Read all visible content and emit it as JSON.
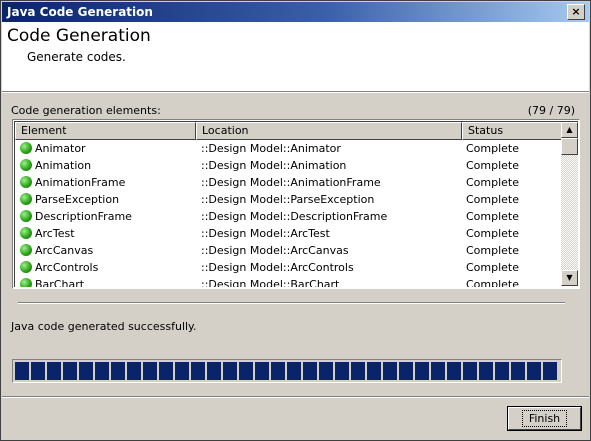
{
  "window": {
    "title": "Java Code Generation",
    "close_glyph": "×"
  },
  "header": {
    "title": "Code Generation",
    "subtitle": "Generate codes."
  },
  "list": {
    "label": "Code generation elements:",
    "count": "(79 / 79)",
    "columns": [
      "Element",
      "Location",
      "Status"
    ],
    "rows": [
      {
        "element": "Animator",
        "location": "::Design Model::Animator",
        "status": "Complete"
      },
      {
        "element": "Animation",
        "location": "::Design Model::Animation",
        "status": "Complete"
      },
      {
        "element": "AnimationFrame",
        "location": "::Design Model::AnimationFrame",
        "status": "Complete"
      },
      {
        "element": "ParseException",
        "location": "::Design Model::ParseException",
        "status": "Complete"
      },
      {
        "element": "DescriptionFrame",
        "location": "::Design Model::DescriptionFrame",
        "status": "Complete"
      },
      {
        "element": "ArcTest",
        "location": "::Design Model::ArcTest",
        "status": "Complete"
      },
      {
        "element": "ArcCanvas",
        "location": "::Design Model::ArcCanvas",
        "status": "Complete"
      },
      {
        "element": "ArcControls",
        "location": "::Design Model::ArcControls",
        "status": "Complete"
      },
      {
        "element": "BarChart",
        "location": "::Design Model::BarChart",
        "status": "Complete"
      }
    ],
    "status_icon": "green-circle-icon",
    "scroll_up_glyph": "▲",
    "scroll_down_glyph": "▼"
  },
  "status_message": "Java code generated successfully.",
  "progress": {
    "fraction": 1.0,
    "color": "#0a246a"
  },
  "buttons": {
    "finish_label": "Finish"
  }
}
